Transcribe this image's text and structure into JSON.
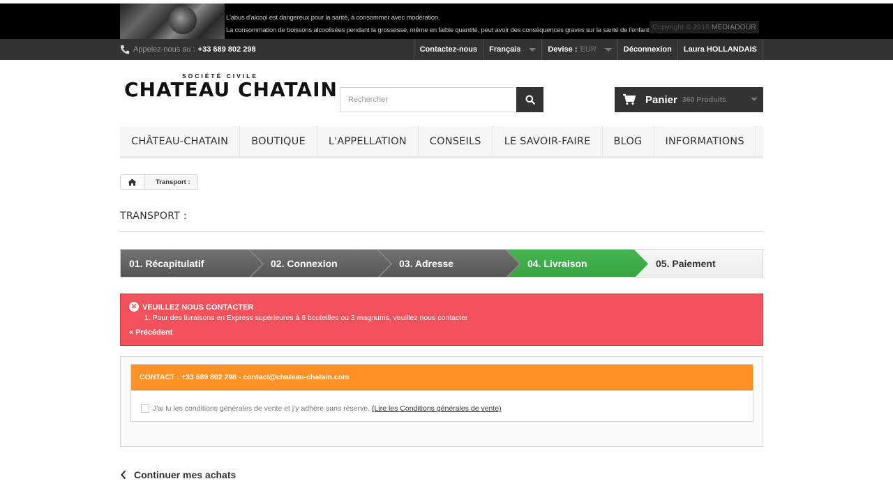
{
  "banner": {
    "warning_line1": "L'abus d'alcool est dangereux pour la santé, à consommer avec modération.",
    "warning_line2": "La consommation de boissons alcoolisées pendant la grossesse, même en faible quantité, peut avoir des conséquences graves sur la santé de l'enfant.",
    "copyright_prefix": "Copyright © 2016",
    "copyright_brand": "MEDIADOUR"
  },
  "topnav": {
    "call_label": "Appelez-nous au :",
    "phone": "+33 689 802 298",
    "contact": "Contactez-nous",
    "language": "Français",
    "currency_label": "Devise :",
    "currency_value": "EUR",
    "logout": "Déconnexion",
    "user": "Laura HOLLANDAIS"
  },
  "header": {
    "logo_small": "SOCIÉTÉ CIVILE",
    "logo_big": "CHATEAU CHATAIN",
    "search_placeholder": "Rechercher",
    "cart_label": "Panier",
    "cart_count": "360 Produits"
  },
  "menu": {
    "items": [
      "CHÂTEAU-CHATAIN",
      "BOUTIQUE",
      "L'APPELLATION",
      "CONSEILS",
      "LE SAVOIR-FAIRE",
      "BLOG",
      "INFORMATIONS"
    ]
  },
  "breadcrumb": {
    "current": "Transport :"
  },
  "page": {
    "title": "TRANSPORT :"
  },
  "steps": {
    "items": [
      "01. Récapitulatif",
      "02. Connexion",
      "03. Adresse",
      "04. Livraison",
      "05. Paiement"
    ],
    "colors": {
      "done": "#5f5f5f",
      "current": "#3fad4a",
      "todo": "#f2f2f2"
    }
  },
  "alert": {
    "heading": "VEUILLEZ NOUS CONTACTER",
    "message": "1. Pour des livraisons en Express supérieures à 6 bouteilles ou 3 magnums, veuillez nous contacter",
    "back": "« Précédent"
  },
  "contact": {
    "header": "CONTACT : +33 689 802 298 - contact@chateau-chatain.com",
    "cgv_text": "J'ai lu les conditions générales de vente et j'y adhère sans réserve.",
    "cgv_link": "(Lire les Conditions générales de vente)"
  },
  "footer": {
    "continue": "Continuer mes achats"
  },
  "icons": [
    "phone-icon",
    "search-icon",
    "cart-icon",
    "home-icon",
    "close-circle-icon",
    "chevron-left-icon",
    "caret-down-icon"
  ]
}
